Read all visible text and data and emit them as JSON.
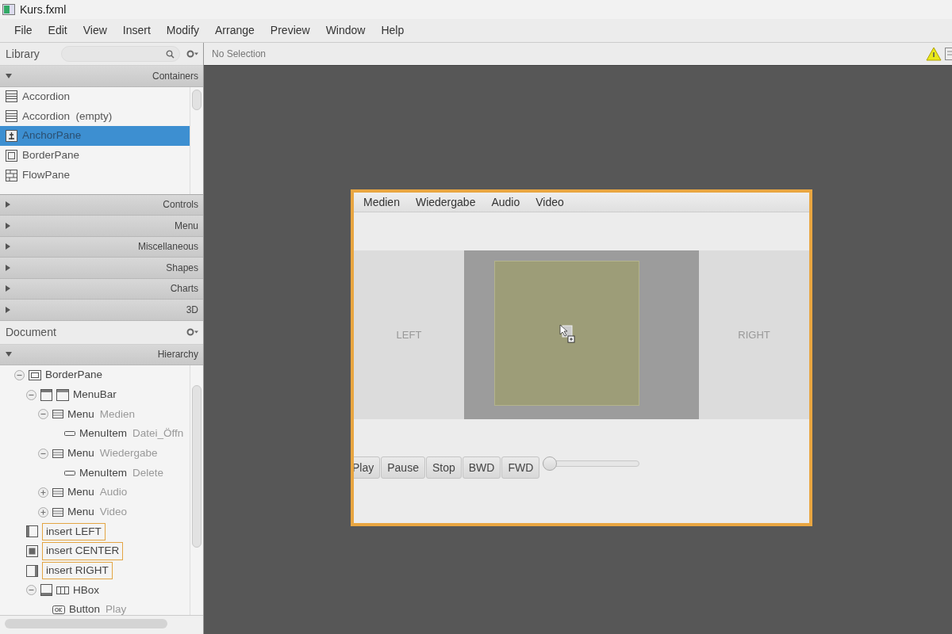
{
  "window": {
    "title": "Kurs.fxml"
  },
  "menu": [
    "File",
    "Edit",
    "View",
    "Insert",
    "Modify",
    "Arrange",
    "Preview",
    "Window",
    "Help"
  ],
  "library": {
    "title": "Library",
    "sections": [
      {
        "label": "Containers",
        "expanded": true,
        "items": [
          {
            "label": "Accordion",
            "kind": "rows",
            "selected": false
          },
          {
            "label": "Accordion  (empty)",
            "kind": "rows",
            "selected": false
          },
          {
            "label": "AnchorPane",
            "kind": "anchor",
            "selected": true
          },
          {
            "label": "BorderPane",
            "kind": "border",
            "selected": false
          },
          {
            "label": "FlowPane",
            "kind": "flow",
            "selected": false
          }
        ]
      },
      {
        "label": "Controls",
        "expanded": false
      },
      {
        "label": "Menu",
        "expanded": false
      },
      {
        "label": "Miscellaneous",
        "expanded": false
      },
      {
        "label": "Shapes",
        "expanded": false
      },
      {
        "label": "Charts",
        "expanded": false
      },
      {
        "label": "3D",
        "expanded": false
      }
    ]
  },
  "document": {
    "title": "Document",
    "section": {
      "label": "Hierarchy",
      "expanded": true
    },
    "tree": [
      {
        "kind": "frame",
        "type": "BorderPane",
        "expanded": true,
        "children": [
          {
            "kind": "menubar",
            "type": "MenuBar",
            "expanded": true,
            "children": [
              {
                "kind": "menu",
                "type": "Menu",
                "label": "Medien",
                "expanded": true,
                "children": [
                  {
                    "kind": "menuitem",
                    "type": "MenuItem",
                    "label": "Datei_Öffn"
                  }
                ]
              },
              {
                "kind": "menu",
                "type": "Menu",
                "label": "Wiedergabe",
                "expanded": true,
                "children": [
                  {
                    "kind": "menuitem",
                    "type": "MenuItem",
                    "label": "Delete"
                  }
                ]
              },
              {
                "kind": "menu",
                "type": "Menu",
                "label": "Audio",
                "expanded": false
              },
              {
                "kind": "menu",
                "type": "Menu",
                "label": "Video",
                "expanded": false
              }
            ]
          },
          {
            "kind": "slotleft",
            "type": "insert LEFT"
          },
          {
            "kind": "slotcenter",
            "type": "insert CENTER"
          },
          {
            "kind": "slotright",
            "type": "insert RIGHT"
          },
          {
            "kind": "hbox",
            "type": "HBox",
            "expanded": true,
            "children": [
              {
                "kind": "button",
                "type": "Button",
                "label": "Play"
              }
            ]
          }
        ]
      }
    ]
  },
  "toolbar": {
    "selection": "No Selection"
  },
  "preview": {
    "menus": [
      "Medien",
      "Wiedergabe",
      "Audio",
      "Video"
    ],
    "left": "LEFT",
    "right": "RIGHT",
    "buttons": [
      "Play",
      "Pause",
      "Stop",
      "BWD",
      "FWD"
    ],
    "slider": {
      "level": 0
    }
  }
}
